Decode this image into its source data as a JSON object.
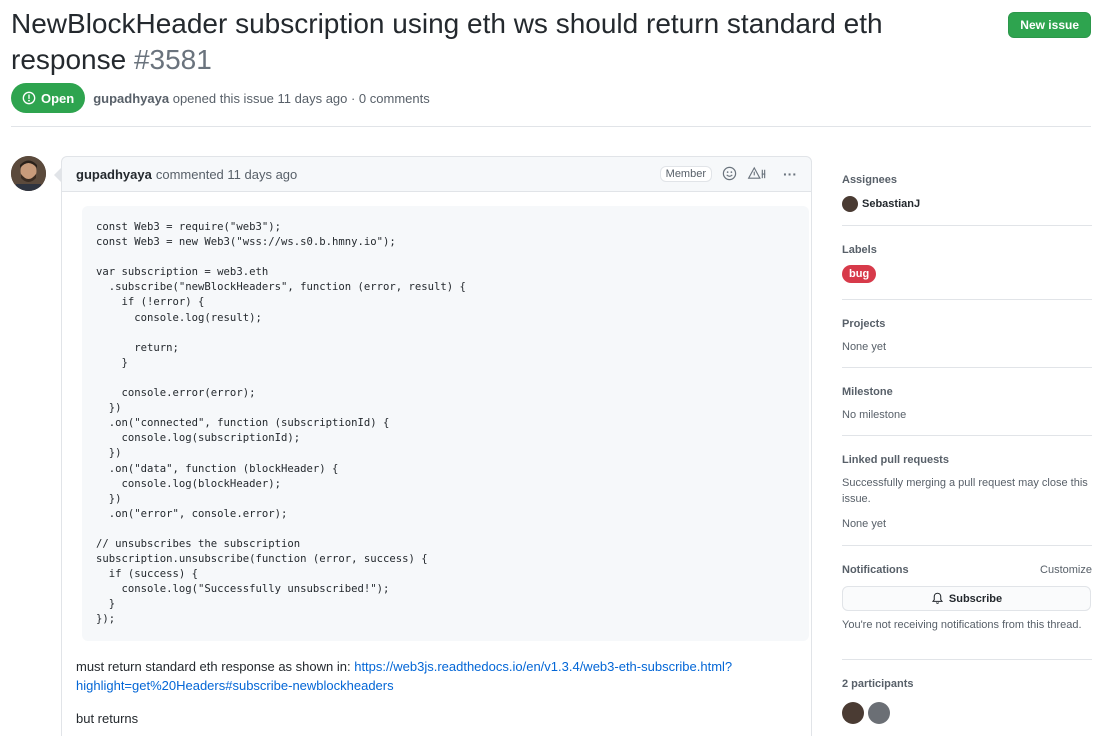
{
  "issue": {
    "title": "NewBlockHeader subscription using eth ws should return standard eth response",
    "number": "#3581",
    "state": "Open",
    "author": "gupadhyaya",
    "opened_text": "opened this issue 11 days ago · 0 comments"
  },
  "header": {
    "new_issue_label": "New issue"
  },
  "comment": {
    "author": "gupadhyaya",
    "time_text": "commented 11 days ago",
    "role_badge": "Member",
    "more_label": "···",
    "code": "const Web3 = require(\"web3\");\nconst Web3 = new Web3(\"wss://ws.s0.b.hmny.io\");\n\nvar subscription = web3.eth\n  .subscribe(\"newBlockHeaders\", function (error, result) {\n    if (!error) {\n      console.log(result);\n\n      return;\n    }\n\n    console.error(error);\n  })\n  .on(\"connected\", function (subscriptionId) {\n    console.log(subscriptionId);\n  })\n  .on(\"data\", function (blockHeader) {\n    console.log(blockHeader);\n  })\n  .on(\"error\", console.error);\n\n// unsubscribes the subscription\nsubscription.unsubscribe(function (error, success) {\n  if (success) {\n    console.log(\"Successfully unsubscribed!\");\n  }\n});",
    "text_before_link": "must return standard eth response as shown in: ",
    "link_text": "https://web3js.readthedocs.io/en/v1.3.4/web3-eth-subscribe.html?highlight=get%20Headers#subscribe-newblockheaders",
    "text_after": "but returns"
  },
  "sidebar": {
    "assignees_heading": "Assignees",
    "assignee_name": "SebastianJ",
    "labels_heading": "Labels",
    "label_bug": "bug",
    "projects_heading": "Projects",
    "projects_value": "None yet",
    "milestone_heading": "Milestone",
    "milestone_value": "No milestone",
    "linked_heading": "Linked pull requests",
    "linked_desc": "Successfully merging a pull request may close this issue.",
    "linked_value": "None yet",
    "notifications_heading": "Notifications",
    "customize_label": "Customize",
    "subscribe_label": "Subscribe",
    "notif_desc": "You're not receiving notifications from this thread.",
    "participants_heading": "2 participants"
  },
  "colors": {
    "open_green": "#2ea44f",
    "bug_red": "#d73a4a",
    "link_blue": "#0366d6"
  }
}
